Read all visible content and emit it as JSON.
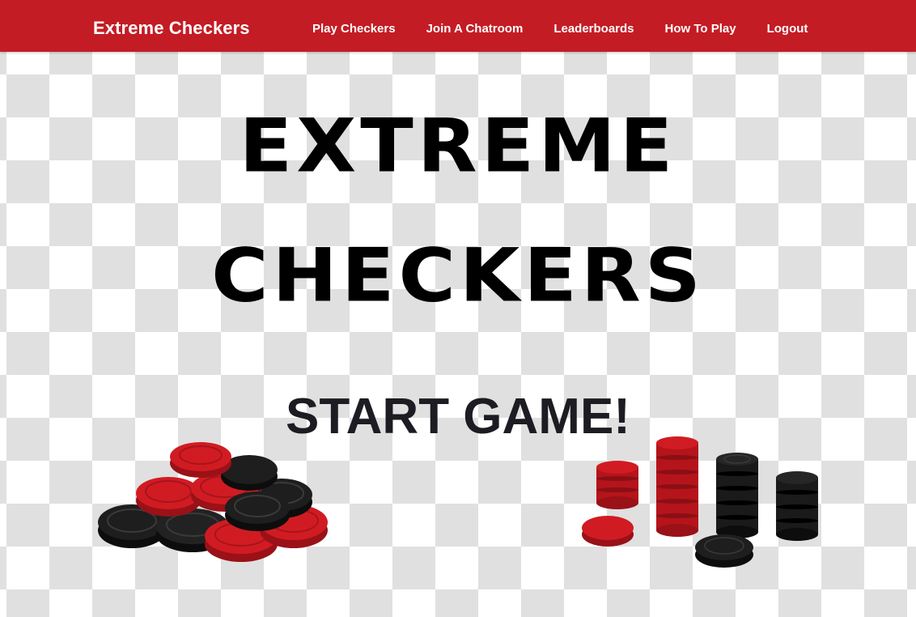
{
  "navbar": {
    "brand": "Extreme Checkers",
    "links": [
      {
        "label": "Play Checkers"
      },
      {
        "label": "Join A Chatroom"
      },
      {
        "label": "Leaderboards"
      },
      {
        "label": "How To Play"
      },
      {
        "label": "Logout"
      }
    ]
  },
  "hero": {
    "title_line1": "EXTREME",
    "title_line2": "CHECKERS",
    "start_button": "START GAME!"
  },
  "colors": {
    "navbar_bg": "#c41c24",
    "checker_red": "#d11b22",
    "checker_black": "#151515",
    "board_gray": "#e0e0e0"
  },
  "images": {
    "left": "pile-of-red-and-black-checkers",
    "right": "stacks-of-red-and-black-checkers"
  }
}
